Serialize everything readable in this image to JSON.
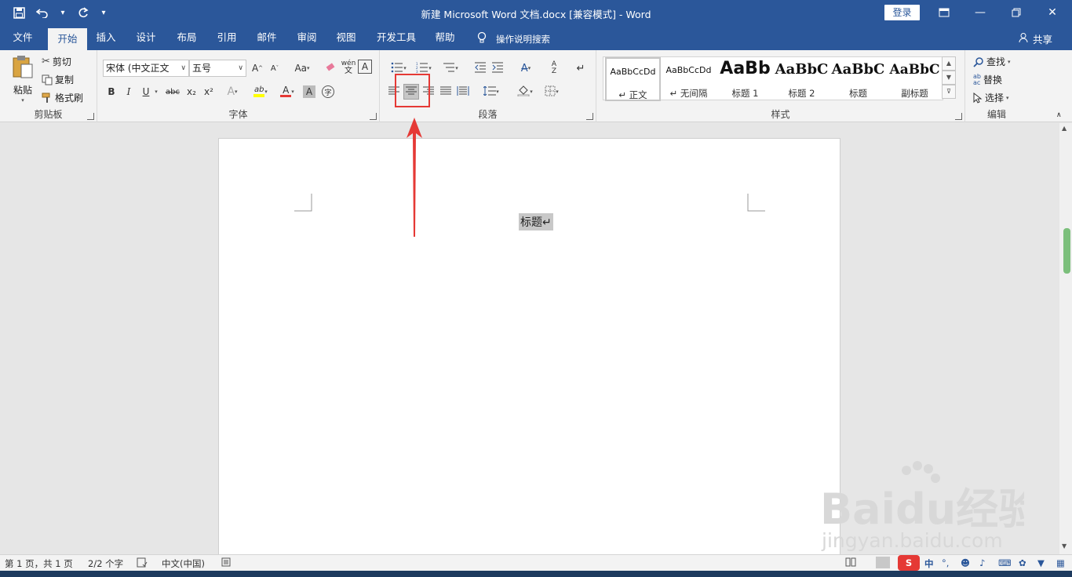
{
  "window": {
    "title": "新建 Microsoft Word 文档.docx [兼容模式] - Word",
    "login_label": "登录",
    "controls": [
      "ribbon-display-icon",
      "minimize-icon",
      "restore-icon",
      "close-icon"
    ]
  },
  "qat": {
    "save_icon": "save-icon",
    "undo_icon": "undo-icon",
    "redo_icon": "redo-icon",
    "customize_icon": "customize-qat-icon"
  },
  "tabs": [
    {
      "label": "文件"
    },
    {
      "label": "开始"
    },
    {
      "label": "插入"
    },
    {
      "label": "设计"
    },
    {
      "label": "布局"
    },
    {
      "label": "引用"
    },
    {
      "label": "邮件"
    },
    {
      "label": "审阅"
    },
    {
      "label": "视图"
    },
    {
      "label": "开发工具"
    },
    {
      "label": "帮助"
    }
  ],
  "tell_me": "操作说明搜索",
  "share": "共享",
  "clipboard": {
    "paste": "粘贴",
    "cut": "剪切",
    "copy": "复制",
    "format_painter": "格式刷",
    "label": "剪贴板"
  },
  "font": {
    "font_name": "宋体 (中文正文",
    "font_size": "五号",
    "label": "字体",
    "change_case": "Aa",
    "phonetic": "wén",
    "bold": "B",
    "italic": "I",
    "underline": "U",
    "strikethrough": "abc",
    "subscript": "x₂",
    "superscript": "x²",
    "grow": "A",
    "shrink": "A",
    "clear": "A",
    "highlight": "ab",
    "font_color": "A",
    "char_shading": "A",
    "enclose": "字",
    "border": "A"
  },
  "paragraph": {
    "label": "段落"
  },
  "styles": {
    "label": "样式",
    "items": [
      {
        "preview": "AaBbCcDd",
        "name": "↵ 正文"
      },
      {
        "preview": "AaBbCcDd",
        "name": "↵ 无间隔"
      },
      {
        "preview": "AaBb",
        "name": "标题 1"
      },
      {
        "preview": "AaBbC",
        "name": "标题 2"
      },
      {
        "preview": "AaBbC",
        "name": "标题"
      },
      {
        "preview": "AaBbC",
        "name": "副标题"
      }
    ]
  },
  "editing": {
    "find": "查找",
    "replace": "替换",
    "select": "选择",
    "label": "编辑"
  },
  "document": {
    "text": "标题↵"
  },
  "status": {
    "page": "第 1 页，共 1 页",
    "words": "2/2 个字",
    "language": "中文(中国)"
  },
  "watermark": {
    "brand": "Baidu经验",
    "url": "jingyan.baidu.com"
  },
  "colors": {
    "accent": "#2b579a",
    "annotation": "#e53935",
    "highlight_yellow": "#ffff00",
    "font_red": "#e53935"
  }
}
